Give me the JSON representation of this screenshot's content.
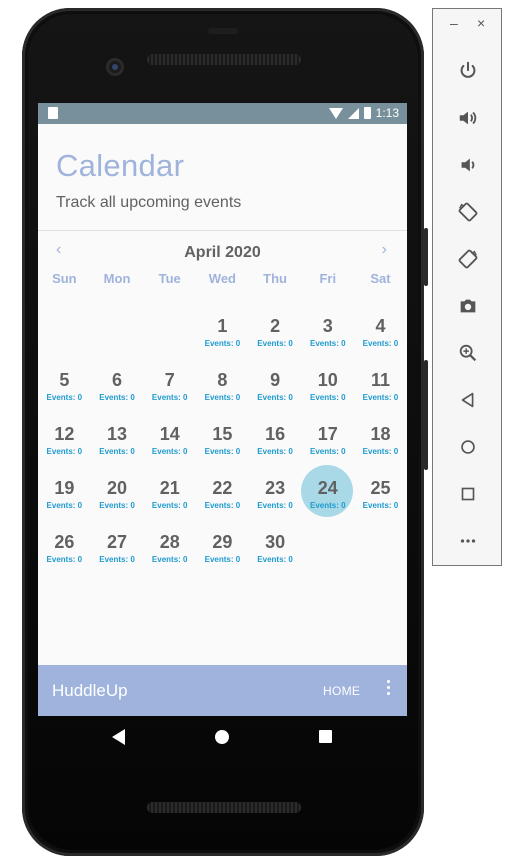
{
  "status_bar": {
    "time": "1:13"
  },
  "screen": {
    "title": "Calendar",
    "subtitle": "Track all upcoming events"
  },
  "calendar": {
    "month_label": "April 2020",
    "prev_icon": "‹",
    "next_icon": "›",
    "weekdays": [
      "Sun",
      "Mon",
      "Tue",
      "Wed",
      "Thu",
      "Fri",
      "Sat"
    ],
    "selected_day": "24",
    "weeks": [
      [
        {
          "d": "",
          "e": ""
        },
        {
          "d": "",
          "e": ""
        },
        {
          "d": "",
          "e": ""
        },
        {
          "d": "1",
          "e": "Events: 0"
        },
        {
          "d": "2",
          "e": "Events: 0"
        },
        {
          "d": "3",
          "e": "Events: 0"
        },
        {
          "d": "4",
          "e": "Events: 0"
        }
      ],
      [
        {
          "d": "5",
          "e": "Events: 0"
        },
        {
          "d": "6",
          "e": "Events: 0"
        },
        {
          "d": "7",
          "e": "Events: 0"
        },
        {
          "d": "8",
          "e": "Events: 0"
        },
        {
          "d": "9",
          "e": "Events: 0"
        },
        {
          "d": "10",
          "e": "Events: 0"
        },
        {
          "d": "11",
          "e": "Events: 0"
        }
      ],
      [
        {
          "d": "12",
          "e": "Events: 0"
        },
        {
          "d": "13",
          "e": "Events: 0"
        },
        {
          "d": "14",
          "e": "Events: 0"
        },
        {
          "d": "15",
          "e": "Events: 0"
        },
        {
          "d": "16",
          "e": "Events: 0"
        },
        {
          "d": "17",
          "e": "Events: 0"
        },
        {
          "d": "18",
          "e": "Events: 0"
        }
      ],
      [
        {
          "d": "19",
          "e": "Events: 0"
        },
        {
          "d": "20",
          "e": "Events: 0"
        },
        {
          "d": "21",
          "e": "Events: 0"
        },
        {
          "d": "22",
          "e": "Events: 0"
        },
        {
          "d": "23",
          "e": "Events: 0"
        },
        {
          "d": "24",
          "e": "Events: 0"
        },
        {
          "d": "25",
          "e": "Events: 0"
        }
      ],
      [
        {
          "d": "26",
          "e": "Events: 0"
        },
        {
          "d": "27",
          "e": "Events: 0"
        },
        {
          "d": "28",
          "e": "Events: 0"
        },
        {
          "d": "29",
          "e": "Events: 0"
        },
        {
          "d": "30",
          "e": "Events: 0"
        },
        {
          "d": "",
          "e": ""
        },
        {
          "d": "",
          "e": ""
        }
      ]
    ]
  },
  "app_bar": {
    "brand": "HuddleUp",
    "home_label": "HOME"
  },
  "toolbar": {
    "minimize": "–",
    "close": "×",
    "buttons": [
      {
        "icon": "power-icon"
      },
      {
        "icon": "volume-up-icon"
      },
      {
        "icon": "volume-down-icon"
      },
      {
        "icon": "rotate-left-icon"
      },
      {
        "icon": "rotate-right-icon"
      },
      {
        "icon": "camera-icon"
      },
      {
        "icon": "zoom-icon"
      },
      {
        "icon": "back-icon"
      },
      {
        "icon": "home-icon"
      },
      {
        "icon": "overview-icon"
      },
      {
        "icon": "more-icon"
      }
    ]
  },
  "colors": {
    "accent": "#9fb3dc",
    "status_bar": "#78909c",
    "event_text": "#1e9bcf",
    "selected_day": "#a9d9e6"
  }
}
